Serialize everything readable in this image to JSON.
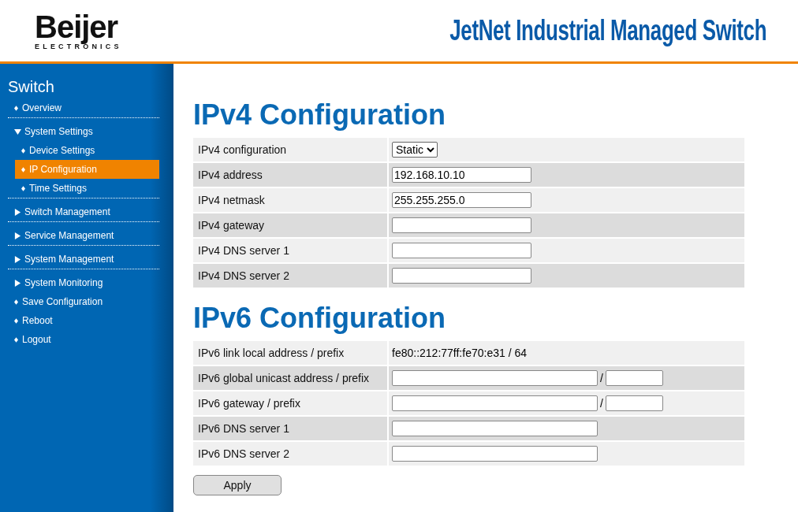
{
  "header": {
    "logo": {
      "name": "Beijer",
      "subtitle": "ELECTRONICS"
    },
    "title": "JetNet Industrial Managed Switch"
  },
  "sidebar": {
    "title": "Switch",
    "sections": [
      [
        {
          "kind": "leaf",
          "label": "Overview",
          "selected": false
        }
      ],
      [
        {
          "kind": "group",
          "label": "System Settings",
          "expanded": true,
          "children": [
            {
              "kind": "leaf",
              "label": "Device Settings",
              "selected": false
            },
            {
              "kind": "leaf",
              "label": "IP Configuration",
              "selected": true
            },
            {
              "kind": "leaf",
              "label": "Time Settings",
              "selected": false
            }
          ]
        }
      ],
      [
        {
          "kind": "group",
          "label": "Switch Management",
          "expanded": false
        }
      ],
      [
        {
          "kind": "group",
          "label": "Service Management",
          "expanded": false
        }
      ],
      [
        {
          "kind": "group",
          "label": "System Management",
          "expanded": false
        }
      ],
      [
        {
          "kind": "group",
          "label": "System Monitoring",
          "expanded": false
        },
        {
          "kind": "leaf",
          "label": "Save Configuration",
          "selected": false
        },
        {
          "kind": "leaf",
          "label": "Reboot",
          "selected": false
        },
        {
          "kind": "leaf",
          "label": "Logout",
          "selected": false
        }
      ]
    ]
  },
  "sections": [
    {
      "title": "IPv4 Configuration",
      "rows": [
        {
          "kind": "select",
          "label": "IPv4 configuration",
          "value": "Static"
        },
        {
          "kind": "input",
          "label": "IPv4 address",
          "value": "192.168.10.10"
        },
        {
          "kind": "input",
          "label": "IPv4 netmask",
          "value": "255.255.255.0"
        },
        {
          "kind": "input",
          "label": "IPv4 gateway"
        },
        {
          "kind": "input",
          "label": "IPv4 DNS server 1"
        },
        {
          "kind": "input",
          "label": "IPv4 DNS server 2"
        }
      ]
    },
    {
      "title": "IPv6 Configuration",
      "rows": [
        {
          "kind": "text",
          "label": "IPv6 link local address / prefix",
          "value": "fe80::212:77ff:fe70:e31 / 64"
        },
        {
          "kind": "prefix",
          "label": "IPv6 global unicast address / prefix",
          "separator": "/"
        },
        {
          "kind": "prefix",
          "label": "IPv6 gateway / prefix",
          "separator": "/"
        },
        {
          "kind": "wide",
          "label": "IPv6 DNS server 1"
        },
        {
          "kind": "wide",
          "label": "IPv6 DNS server 2"
        }
      ]
    }
  ],
  "apply_button": "Apply"
}
